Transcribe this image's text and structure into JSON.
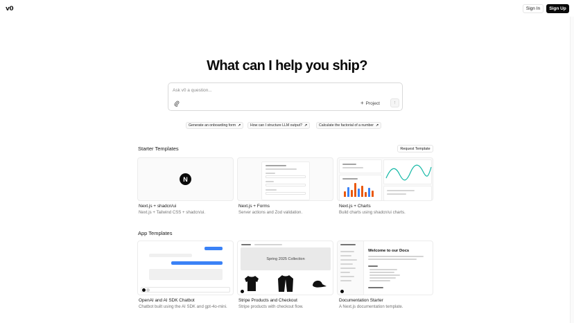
{
  "header": {
    "logo": "v0",
    "sign_in": "Sign In",
    "sign_up": "Sign Up"
  },
  "hero": {
    "title": "What can I help you ship?"
  },
  "prompt": {
    "placeholder": "Ask v0 a question...",
    "project_label": "Project",
    "send_icon": "arrow-up-icon",
    "attach_icon": "paperclip-icon"
  },
  "suggestions": [
    {
      "label": "Generate an onboarding form",
      "icon": "arrow-up-right-icon"
    },
    {
      "label": "How can I structure LLM output?",
      "icon": "arrow-up-right-icon"
    },
    {
      "label": "Calculate the factorial of a number",
      "icon": "arrow-up-right-icon"
    }
  ],
  "starter": {
    "title": "Starter Templates",
    "request_label": "Request Template",
    "cards": [
      {
        "title": "Next.js + shadcn/ui",
        "desc": "Next.js + Tailwind CSS + shadcn/ui."
      },
      {
        "title": "Next.js + Forms",
        "desc": "Server actions and Zod validation."
      },
      {
        "title": "Next.js + Charts",
        "desc": "Build charts using shadcn/ui charts."
      }
    ]
  },
  "app": {
    "title": "App Templates",
    "cards": [
      {
        "title": "OpenAI and AI SDK Chatbot",
        "desc": "Chatbot built using the AI SDK and gpt-4o-mini."
      },
      {
        "title": "Stripe Products and Checkout",
        "desc": "Stripe products with checkout flow."
      },
      {
        "title": "Documentation Starter",
        "desc": "A Next.js documentation template."
      }
    ]
  },
  "previews": {
    "next_logo_letter": "N",
    "stripe_banner": "Spring 2025 Collection",
    "docs_heading": "Welcome to our Docs"
  },
  "colors": {
    "accent_blue": "#3b82f6",
    "chart_teal": "#14b8a6",
    "chart_orange": "#ea580c",
    "dark": "#0a0a0a"
  }
}
